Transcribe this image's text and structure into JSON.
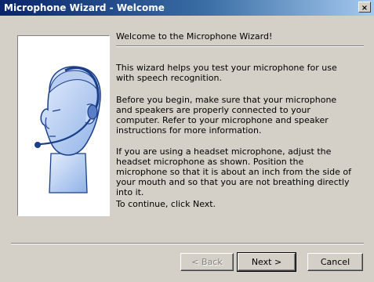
{
  "window": {
    "title": "Microphone Wizard - Welcome",
    "close_glyph": "×"
  },
  "content": {
    "heading": "Welcome to the Microphone Wizard!",
    "paragraphs": [
      "This wizard helps you test your microphone for use with speech recognition.",
      "Before you begin, make sure that your microphone and speakers are properly connected to your computer. Refer to your microphone and speaker instructions for more information.",
      "If you are using a headset microphone, adjust the headset microphone as shown. Position the microphone so that it is about an inch from the side of your mouth and so that you are not breathing directly into it.",
      "To continue, click Next."
    ]
  },
  "image": {
    "subject": "head-with-headset-illustration",
    "colors": {
      "line": "#1a3f8a",
      "shade": "#8fb2e8",
      "light": "#e6eefc"
    }
  },
  "buttons": {
    "back": "< Back",
    "next": "Next >",
    "cancel": "Cancel"
  },
  "theme": {
    "face": "#d4d0c8",
    "titlebar_start": "#0a246a",
    "titlebar_end": "#a6caf0"
  }
}
